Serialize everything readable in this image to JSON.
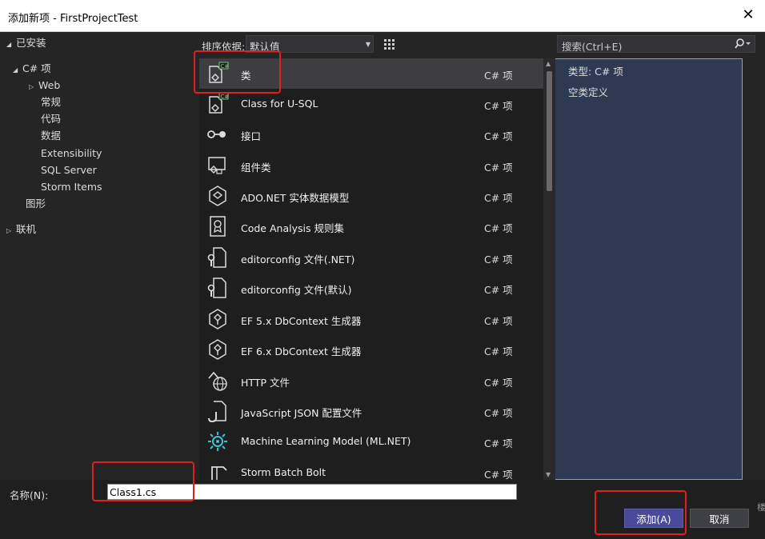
{
  "window": {
    "title": "添加新项 - FirstProjectTest",
    "close_glyph": "✕"
  },
  "tree": [
    {
      "label": "已安装",
      "tri": "◢"
    },
    {
      "label": "C# 项",
      "tri": "◢"
    },
    {
      "label": "Web",
      "tri": "▷"
    },
    {
      "label": "常规",
      "tri": ""
    },
    {
      "label": "代码",
      "tri": ""
    },
    {
      "label": "数据",
      "tri": ""
    },
    {
      "label": "Extensibility",
      "tri": ""
    },
    {
      "label": "SQL Server",
      "tri": ""
    },
    {
      "label": "Storm Items",
      "tri": ""
    },
    {
      "label": "图形",
      "tri": ""
    },
    {
      "label": "联机",
      "tri": "▷"
    }
  ],
  "toolbar": {
    "sort_label": "排序依据:",
    "sort_value": "默认值"
  },
  "search": {
    "placeholder": "搜索(Ctrl+E)"
  },
  "items": [
    {
      "name": "类",
      "lang": "C# 项",
      "icon": "class-icon"
    },
    {
      "name": "Class for U-SQL",
      "lang": "C# 项",
      "icon": "usql-class-icon"
    },
    {
      "name": "接口",
      "lang": "C# 项",
      "icon": "interface-icon"
    },
    {
      "name": "组件类",
      "lang": "C# 项",
      "icon": "component-icon"
    },
    {
      "name": "ADO.NET 实体数据模型",
      "lang": "C# 项",
      "icon": "entity-model-icon"
    },
    {
      "name": "Code Analysis 规则集",
      "lang": "C# 项",
      "icon": "ruleset-icon"
    },
    {
      "name": "editorconfig 文件(.NET)",
      "lang": "C# 项",
      "icon": "editorconfig-icon"
    },
    {
      "name": "editorconfig 文件(默认)",
      "lang": "C# 项",
      "icon": "editorconfig-icon"
    },
    {
      "name": "EF 5.x DbContext 生成器",
      "lang": "C# 项",
      "icon": "dbcontext-icon"
    },
    {
      "name": "EF 6.x DbContext 生成器",
      "lang": "C# 项",
      "icon": "dbcontext-icon"
    },
    {
      "name": "HTTP 文件",
      "lang": "C# 项",
      "icon": "http-file-icon"
    },
    {
      "name": "JavaScript JSON 配置文件",
      "lang": "C# 项",
      "icon": "json-config-icon"
    },
    {
      "name": "Machine Learning Model (ML.NET)",
      "lang": "C# 项",
      "icon": "ml-model-icon"
    },
    {
      "name": "Storm Batch Bolt",
      "lang": "C# 项",
      "icon": "storm-bolt-icon"
    }
  ],
  "details": {
    "type_line": "类型:  C# 项",
    "description": "空类定义"
  },
  "bottom": {
    "name_label": "名称(N):",
    "name_value": "Class1.cs",
    "add_label": "添加(A)",
    "cancel_label": "取消",
    "edge_char": "楼"
  },
  "colors": {
    "accent": "#4a4a9a",
    "highlight": "#e02020",
    "background": "#252526"
  }
}
